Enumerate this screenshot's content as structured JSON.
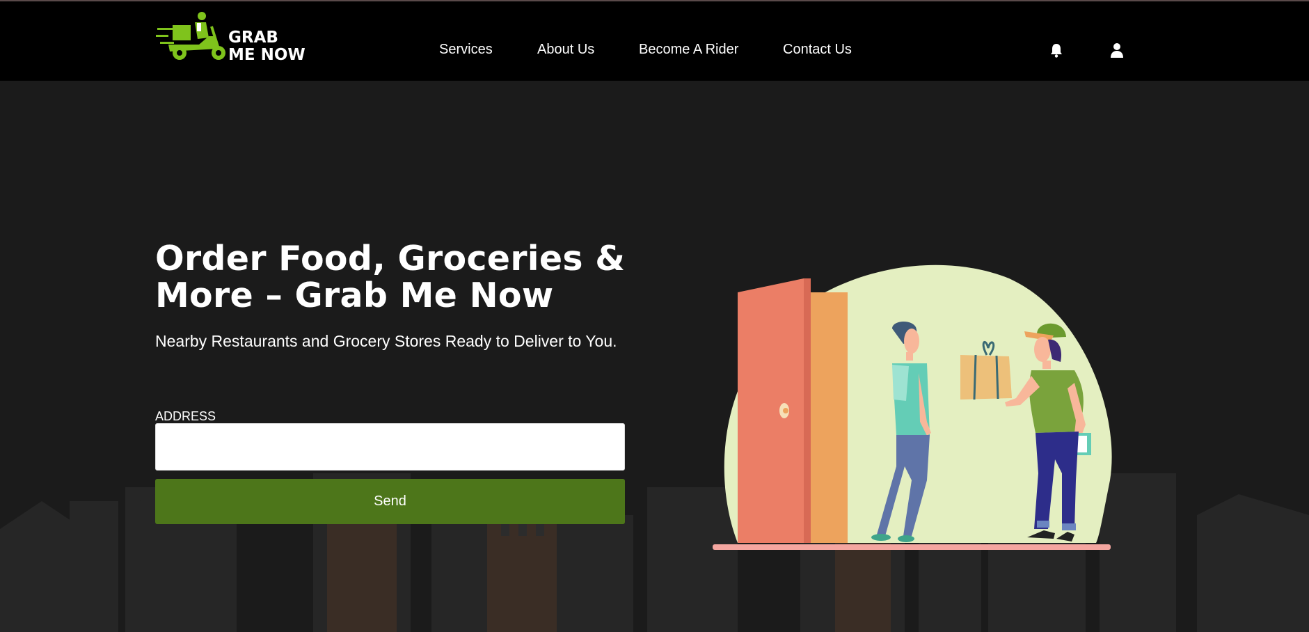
{
  "header": {
    "logo": {
      "line1": "GRAB",
      "line2": "ME NOW"
    },
    "nav": [
      {
        "label": "Services"
      },
      {
        "label": "About Us"
      },
      {
        "label": "Become A Rider"
      },
      {
        "label": "Contact Us"
      }
    ],
    "icons": [
      "bell-icon",
      "user-icon"
    ]
  },
  "hero": {
    "title_line1": "Order Food, Groceries &",
    "title_line2": "More – Grab Me Now",
    "subtitle": "Nearby Restaurants and Grocery Stores Ready to Deliver to You.",
    "address_label": "ADDRESS",
    "address_value": "",
    "send_label": "Send"
  },
  "colors": {
    "header_bg": "#000000",
    "page_bg": "#1b1b1b",
    "brand_green": "#4d761a",
    "logo_green": "#7fc31c"
  }
}
